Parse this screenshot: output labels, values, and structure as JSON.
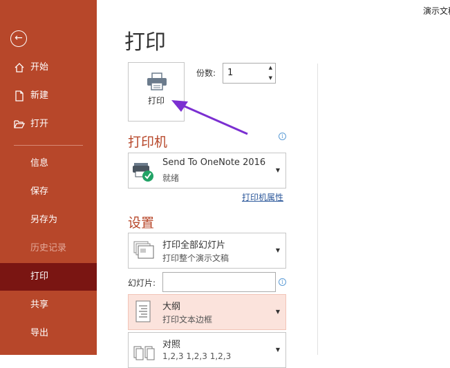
{
  "window": {
    "corner_title": "演示文稿"
  },
  "sidebar": {
    "back_icon": "back-arrow-icon",
    "items": [
      {
        "label": "开始",
        "icon": "home-icon"
      },
      {
        "label": "新建",
        "icon": "new-file-icon"
      },
      {
        "label": "打开",
        "icon": "open-folder-icon"
      },
      {
        "label": "信息"
      },
      {
        "label": "保存"
      },
      {
        "label": "另存为"
      },
      {
        "label": "历史记录",
        "disabled": true
      },
      {
        "label": "打印",
        "active": true
      },
      {
        "label": "共享"
      },
      {
        "label": "导出"
      }
    ]
  },
  "main": {
    "title": "打印",
    "print_button": {
      "label": "打印",
      "icon": "printer-icon"
    },
    "copies": {
      "label": "份数:",
      "value": "1"
    },
    "printer": {
      "heading": "打印机",
      "name": "Send To OneNote 2016",
      "status": "就绪",
      "properties_link": "打印机属性"
    },
    "settings": {
      "heading": "设置",
      "range": {
        "title": "打印全部幻灯片",
        "subtitle": "打印整个演示文稿"
      },
      "slides_label": "幻灯片:",
      "slides_value": "",
      "layout": {
        "title": "大纲",
        "subtitle": "打印文本边框"
      },
      "collate": {
        "title": "对照",
        "subtitle": "1,2,3    1,2,3    1,2,3"
      }
    }
  },
  "colors": {
    "sidebar": "#b7472a",
    "active": "#7a1512",
    "accent": "#b7472a",
    "link": "#2b579a",
    "arrow": "#7b2fd1"
  }
}
